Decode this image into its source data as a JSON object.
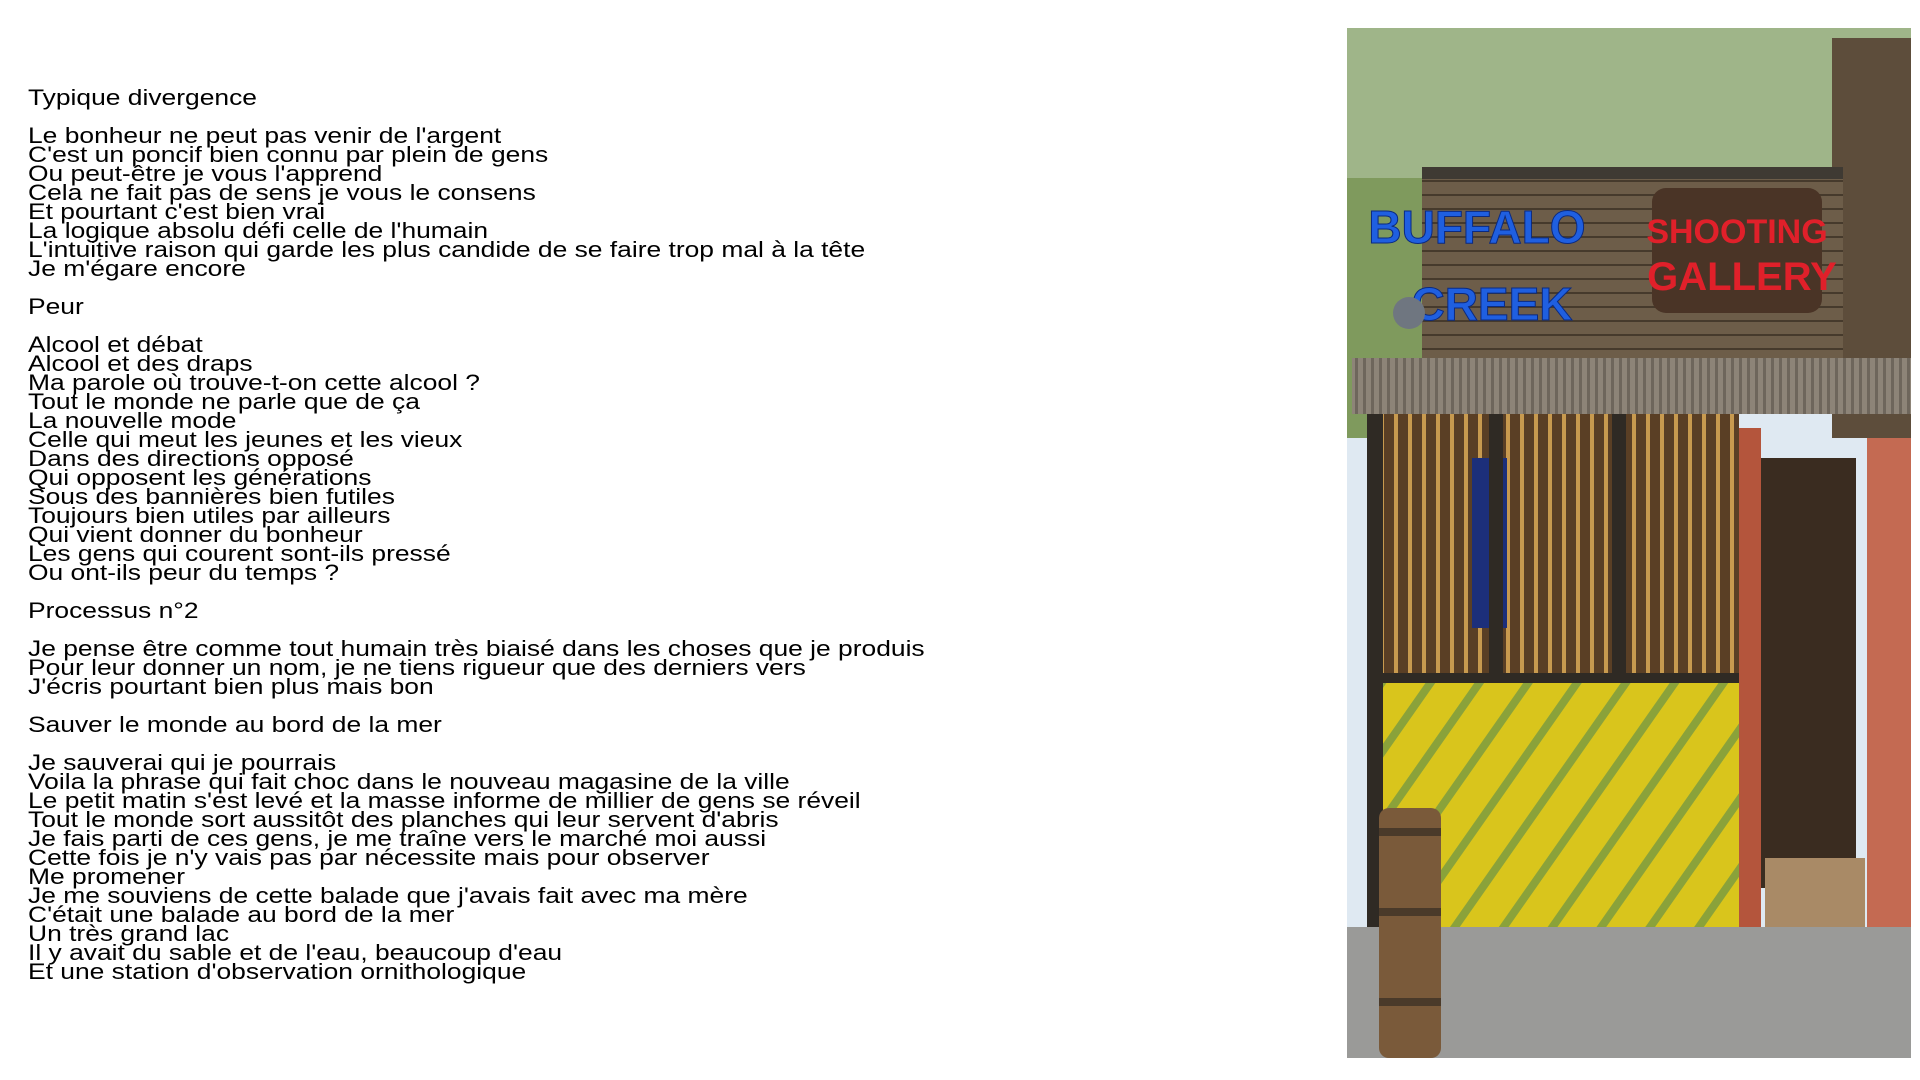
{
  "sections": [
    {
      "title": "Typique divergence",
      "lines": [
        "Le bonheur ne peut pas venir de l'argent",
        "C'est un poncif bien connu par plein de gens",
        "Ou peut-être je vous l'apprend",
        "Cela ne fait pas de sens je vous le consens",
        "Et pourtant c'est bien vrai",
        "La logique absolu défi celle de l'humain",
        "L'intuitive raison qui garde les plus candide de se faire trop mal à la tête",
        "Je m'égare encore"
      ]
    },
    {
      "title": "Peur",
      "lines": [
        "Alcool et débat",
        "Alcool et des draps",
        "Ma parole où trouve-t-on cette alcool ?",
        "Tout le monde ne parle que de ça",
        "La nouvelle mode",
        "Celle qui meut les jeunes et les vieux",
        "Dans des directions opposé",
        "Qui opposent les générations",
        "Sous des bannières bien futiles",
        "Toujours bien utiles par ailleurs",
        "Qui vient donner du bonheur",
        "Les gens qui courent sont-ils pressé",
        "Ou ont-ils peur du temps ?"
      ]
    },
    {
      "title": "Processus n°2",
      "lines": [
        "Je pense être comme tout humain très biaisé dans les choses que je produis",
        "Pour leur donner un nom, je ne tiens rigueur que des derniers vers",
        "J'écris pourtant bien plus mais bon"
      ]
    },
    {
      "title": "Sauver le monde au bord de la mer",
      "lines": [
        "Je sauverai qui je pourrais",
        "Voila la phrase qui fait choc dans le nouveau magasine de la ville",
        "Le petit matin s'est levé et la masse informe de millier de gens se réveil",
        "Tout le monde sort aussitôt des planches qui leur servent d'abris",
        "Je fais parti de ces gens, je me traîne vers le marché moi aussi",
        "Cette fois je n'y vais pas par nécessite mais pour observer",
        "Me promener",
        "Je me souviens de cette balade que j'avais fait avec ma mère",
        "C'était une balade au bord de la mer",
        "Un très grand lac",
        "Il y avait du sable et de l'eau, beaucoup d'eau",
        "Et une station d'observation ornithologique"
      ]
    }
  ],
  "photo": {
    "sign_left": [
      "BUFFALO",
      "CREEK"
    ],
    "sign_right": [
      "SHOOTING",
      "GALLERY"
    ],
    "colors": {
      "wood": "#6b5a45",
      "yellow": "#d8c21a",
      "red_sign": "#e0202a",
      "blue_sign": "#1f5fe0",
      "door": "#b4553c"
    }
  }
}
